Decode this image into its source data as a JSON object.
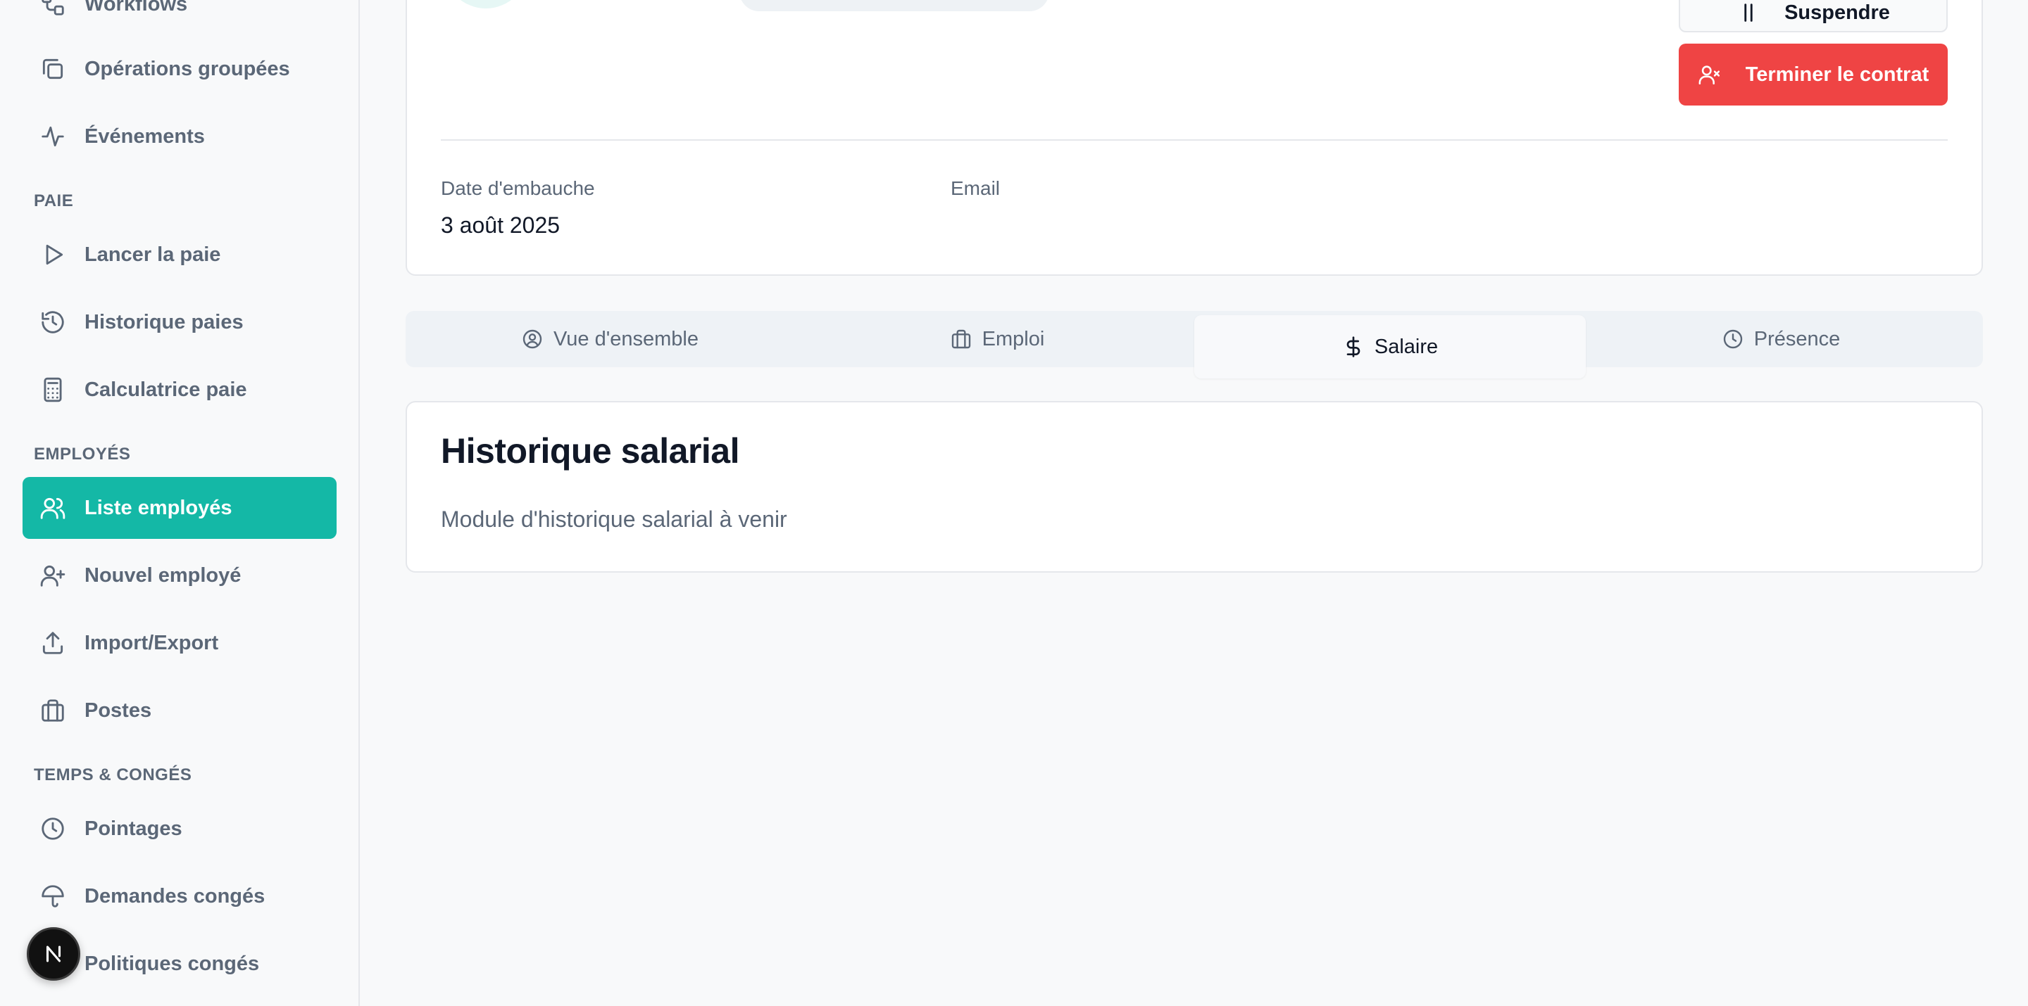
{
  "sidebar": {
    "top_items": [
      {
        "label": "Workflows",
        "icon": "workflow-icon"
      },
      {
        "label": "Opérations groupées",
        "icon": "copy-icon"
      },
      {
        "label": "Événements",
        "icon": "activity-icon"
      }
    ],
    "sections": [
      {
        "title": "PAIE",
        "items": [
          {
            "label": "Lancer la paie",
            "icon": "play-icon"
          },
          {
            "label": "Historique paies",
            "icon": "history-icon"
          },
          {
            "label": "Calculatrice paie",
            "icon": "calculator-icon"
          }
        ]
      },
      {
        "title": "EMPLOYÉS",
        "items": [
          {
            "label": "Liste employés",
            "icon": "users-icon",
            "active": true
          },
          {
            "label": "Nouvel employé",
            "icon": "user-plus-icon"
          },
          {
            "label": "Import/Export",
            "icon": "upload-icon"
          },
          {
            "label": "Postes",
            "icon": "briefcase-icon"
          }
        ]
      },
      {
        "title": "TEMPS & CONGÉS",
        "items": [
          {
            "label": "Pointages",
            "icon": "clock-icon"
          },
          {
            "label": "Demandes congés",
            "icon": "umbrella-icon"
          },
          {
            "label": "Politiques congés",
            "icon": "policy-icon"
          }
        ]
      }
    ],
    "badge_letter": "N"
  },
  "profile": {
    "suspend_label": "Suspendre",
    "terminate_label": "Terminer le contrat",
    "hire_date_label": "Date d'embauche",
    "hire_date_value": "3 août 2025",
    "email_label": "Email"
  },
  "tabs": [
    {
      "label": "Vue d'ensemble",
      "icon": "user-circle-icon"
    },
    {
      "label": "Emploi",
      "icon": "briefcase-icon"
    },
    {
      "label": "Salaire",
      "icon": "dollar-icon",
      "active": true
    },
    {
      "label": "Présence",
      "icon": "clock-icon"
    }
  ],
  "salary": {
    "title": "Historique salarial",
    "description": "Module d'historique salarial à venir"
  },
  "colors": {
    "accent": "#14b8a6",
    "danger": "#ef4444",
    "muted_text": "#5b6777"
  }
}
